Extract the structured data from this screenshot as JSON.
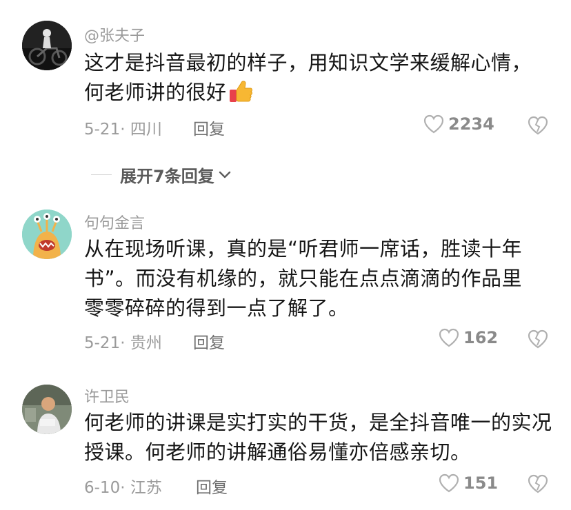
{
  "comments": [
    {
      "username": "@张夫子",
      "text": "这才是抖音最初的样子，用知识文学来缓解心情，何老师讲的很好",
      "emoji": "thumbs-up-icon",
      "date_location": "5-21· 四川",
      "reply_label": "回复",
      "likes": "2234"
    },
    {
      "username": "句句金言",
      "text": "从在现场听课，真的是“听君师一席话，胜读十年书”。而没有机缘的，就只能在点点滴滴的作品里零零碎碎的得到一点了解了。",
      "date_location": "5-21· 贵州",
      "reply_label": "回复",
      "likes": "162"
    },
    {
      "username": "许卫民",
      "text": "何老师的讲课是实打实的干货，是全抖音唯一的实况授课。何老师的讲解通俗易懂亦倍感亲切。",
      "date_location": "6-10· 江苏",
      "reply_label": "回复",
      "likes": "151"
    }
  ],
  "expand_replies_label": "展开7条回复",
  "colors": {
    "text": "#161616",
    "muted": "#9a9a9a",
    "icon": "#b0b0b0"
  }
}
